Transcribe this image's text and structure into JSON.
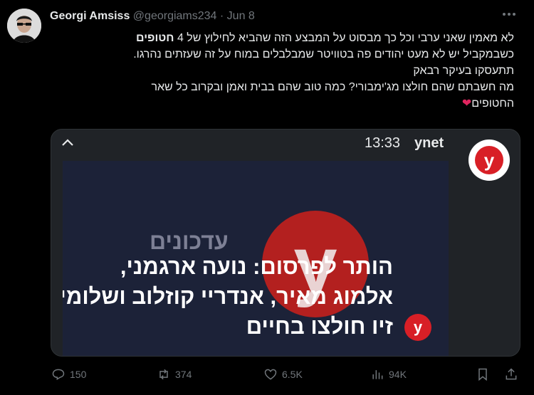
{
  "tweet": {
    "author_name": "Georgi Amsiss",
    "handle": "@georgiams234",
    "separator": "·",
    "date": "Jun 8",
    "more_icon": "more-horizontal-icon",
    "text_lines": {
      "line1_prefix": "לא מאמין שאני ערבי וכל כך מבסוט על המבצע הזה שהביא לחילוץ של 4",
      "line1_bold": "חטופים",
      "line2": "כשבמקביל יש לא מעט יהודים פה בטוויטר שמבלבלים במוח על זה שעזתים נהרגו.",
      "line3": "תתעסקו בעיקר רבאק",
      "line4": "מה חשבתם שהם חולצו מג'ימבורי? כמה טוב שהם בבית ואמן ובקרוב כל שאר",
      "line5": "החטופים",
      "heart": "❤"
    }
  },
  "media": {
    "collapse_icon": "chevron-up-icon",
    "time": "13:33",
    "source": "ynet",
    "logo_letter": "y",
    "video": {
      "watermark": "עדכונים",
      "big_logo_letter": "y",
      "headline_lines": [
        "הותר לפרסום: נועה ארגמני,",
        "אלמוג מאיר, אנדריי קוזלוב ושלומי",
        "זיו חולצו בחיים"
      ],
      "small_logo_letter": "y"
    }
  },
  "actions": {
    "replies": "150",
    "reposts": "374",
    "likes": "6.5K",
    "views": "94K"
  },
  "colors": {
    "background": "#000000",
    "text": "#e7e9ea",
    "muted": "#71767b",
    "ynet_red": "#d81f26",
    "heart": "#e0245e"
  }
}
